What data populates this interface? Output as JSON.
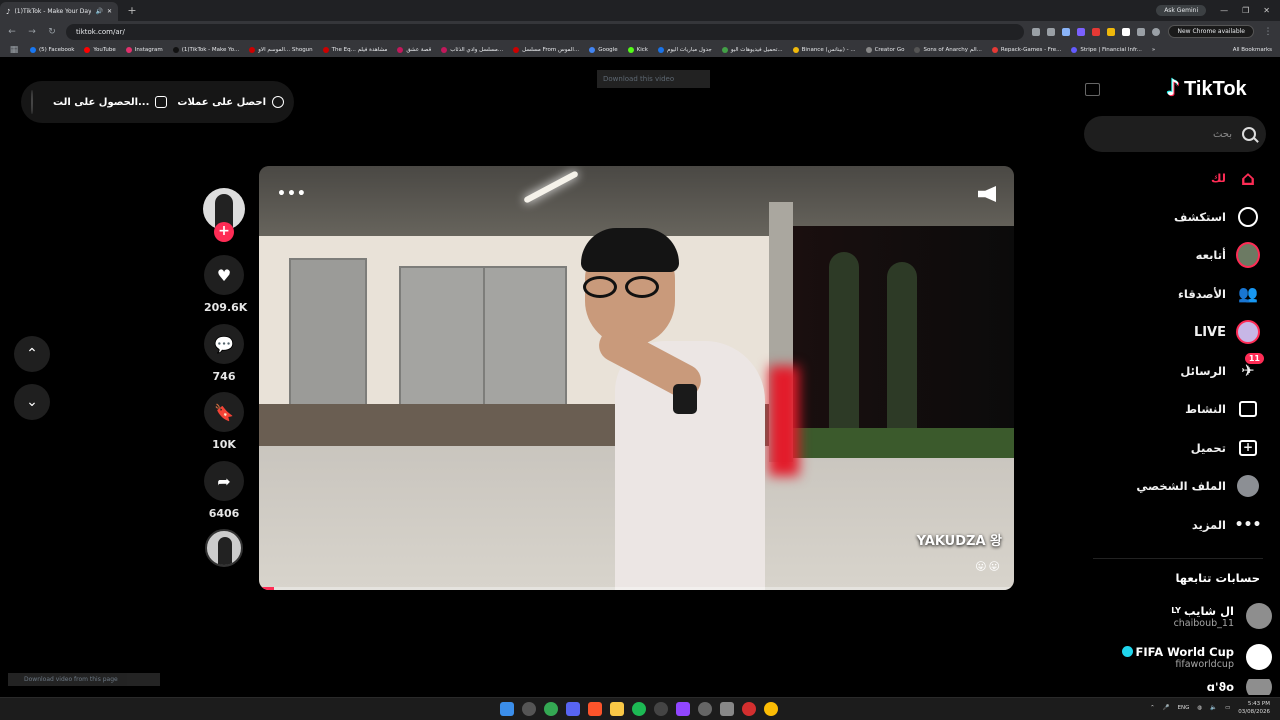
{
  "browser": {
    "tab_title": "(1)TikTok - Make Your Day",
    "new_tab": "+",
    "ask_gemini": "Ask Gemini",
    "url": "tiktok.com/ar/",
    "chrome_available": "New Chrome available",
    "bookmarks": [
      {
        "label": "(5) Facebook",
        "color": "#1877f2"
      },
      {
        "label": "YouTube",
        "color": "#ff0000"
      },
      {
        "label": "Instagram",
        "color": "#e1306c"
      },
      {
        "label": "(1)TikTok - Make Yo...",
        "color": "#111111"
      },
      {
        "label": "الموسم الاو... Shogun",
        "color": "#cc0000"
      },
      {
        "label": "The Eq... مشاهدة فيلم",
        "color": "#cc0000"
      },
      {
        "label": "قصة عشق",
        "color": "#c2185b"
      },
      {
        "label": "مسلسل وادي الذئاب...",
        "color": "#c2185b"
      },
      {
        "label": "مسلسل From الموس...",
        "color": "#cc0000"
      },
      {
        "label": "Google",
        "color": "#4285f4"
      },
      {
        "label": "Kick",
        "color": "#53fc18"
      },
      {
        "label": "جدول مباريات اليوم",
        "color": "#1a73e8"
      },
      {
        "label": "تحميل فيديوهات اليو...",
        "color": "#43a047"
      },
      {
        "label": "Binance (بينانس) - ...",
        "color": "#f0b90b"
      },
      {
        "label": "Creator Go",
        "color": "#888888"
      },
      {
        "label": "Sons of Anarchy الم...",
        "color": "#555555"
      },
      {
        "label": "Repack-Games - Fre...",
        "color": "#e53935"
      },
      {
        "label": "Stripe | Financial Infr...",
        "color": "#635bff"
      }
    ],
    "all_bookmarks": "All Bookmarks"
  },
  "top_pill": {
    "get_coins": "احصل على عملات",
    "get_app": "الحصول على الت..."
  },
  "download_top": "Download this video",
  "download_bottom": "Download video from this page",
  "nav": {
    "up": "⌃",
    "down": "⌄"
  },
  "actions": {
    "follow": "+",
    "likes": "209.6K",
    "comments": "746",
    "saves": "10K",
    "shares": "6406"
  },
  "video": {
    "more": "•••",
    "caption": "YAKUDZA 왕",
    "emojis": "😛😛",
    "progress": 0.02
  },
  "sidebar": {
    "logo_note": "♪",
    "logo_text": "TikTok",
    "search_placeholder": "بحث",
    "menu": [
      {
        "label": "لك",
        "icon": "home-icon",
        "active": true
      },
      {
        "label": "استكشف",
        "icon": "compass-icon",
        "active": false
      },
      {
        "label": "أتابعه",
        "icon": "following-avatar",
        "active": false
      },
      {
        "label": "الأصدقاء",
        "icon": "friends-icon",
        "active": false
      },
      {
        "label": "LIVE",
        "icon": "live-icon",
        "active": false
      },
      {
        "label": "الرسائل",
        "icon": "messages-icon",
        "active": false,
        "badge": "11"
      },
      {
        "label": "النشاط",
        "icon": "activity-icon",
        "active": false
      },
      {
        "label": "تحميل",
        "icon": "upload-icon",
        "active": false
      },
      {
        "label": "الملف الشخصي",
        "icon": "profile-avatar",
        "active": false
      },
      {
        "label": "المزيد",
        "icon": "more-icon",
        "active": false
      }
    ],
    "following_title": "حسابات تتابعها",
    "accounts": [
      {
        "name": "ال شايب",
        "suffix": "LY",
        "handle": "chaiboub_11"
      },
      {
        "name": "FIFA World Cup",
        "handle": "fifaworldcup",
        "verified": true
      },
      {
        "name": "ɑ'ϑo",
        "handle": ""
      }
    ]
  },
  "taskbar": {
    "lang": "ENG",
    "time": "5:43 PM",
    "date": "03/08/2026"
  },
  "colors": {
    "accent": "#fe2c55",
    "cyan": "#25f4ee",
    "bg": "#000000"
  }
}
